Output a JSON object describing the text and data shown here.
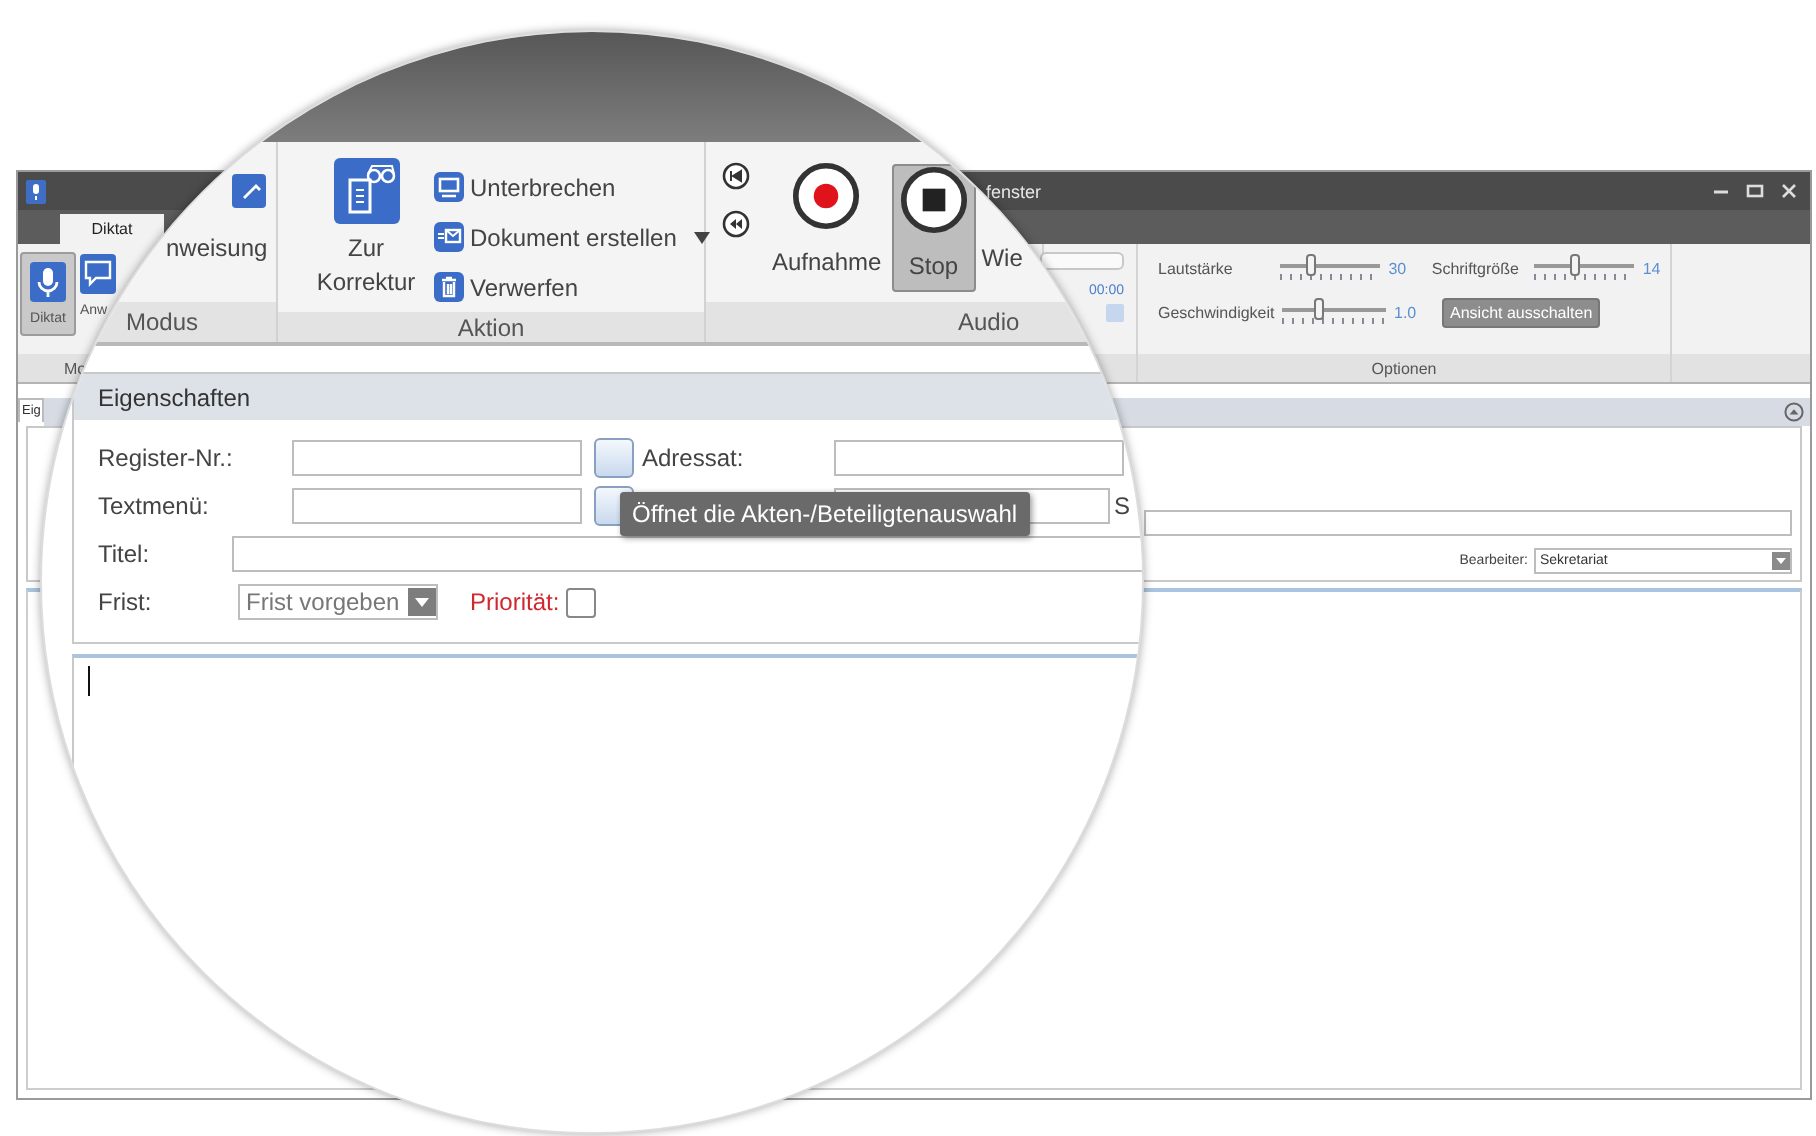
{
  "window": {
    "title": "fenster"
  },
  "ribbon_tabs": [
    {
      "label": "Diktat",
      "selected": true
    }
  ],
  "modus_group": {
    "label": "Mo",
    "buttons": [
      {
        "label": "Diktat",
        "kind": "mic",
        "selected": true
      },
      {
        "label": "Anw",
        "kind": "bubble",
        "selected": false
      }
    ]
  },
  "audio_group": {
    "time": "00:00"
  },
  "options_group": {
    "label": "Optionen",
    "sliders": [
      {
        "label": "Lautstärke",
        "level": 0.3,
        "reading": "30"
      },
      {
        "label": "Schriftgröße",
        "level": 0.4,
        "reading": "14"
      },
      {
        "label": "Geschwindigkeit",
        "level": 0.35,
        "reading": "1.0"
      }
    ],
    "button": "Ansicht ausschalten"
  },
  "panel_tab": {
    "label": "Eig"
  },
  "panel": {
    "editor_label": "Bearbeiter:",
    "editor_value": "Sekretariat"
  },
  "magnifier": {
    "ribbon": {
      "modus": {
        "label": "Modus",
        "button": "nweisung"
      },
      "aktion": {
        "label": "Aktion",
        "large_button": "Zur Korrektur",
        "small_buttons": [
          {
            "label": "Unterbrechen",
            "kind": "pause",
            "dropdown": false
          },
          {
            "label": "Dokument erstellen",
            "kind": "document",
            "dropdown": true
          },
          {
            "label": "Verwerfen",
            "kind": "trash",
            "dropdown": false
          }
        ]
      },
      "audio": {
        "label": "Audio",
        "buttons": [
          {
            "label": "Aufnahme",
            "kind": "record",
            "selected": false
          },
          {
            "label": "Stop",
            "kind": "stop",
            "selected": true
          },
          {
            "label": "Wie",
            "kind": "text",
            "selected": false
          }
        ]
      }
    },
    "properties": {
      "title": "Eigenschaften",
      "register_label": "Register-Nr.:",
      "addressee_label": "Adressat:",
      "textmenu_label": "Textmenü:",
      "cut_label": "S",
      "title_label": "Titel:",
      "deadline_label": "Frist:",
      "deadline_value": "Frist vorgeben",
      "priority_label": "Priorität:",
      "priority_checked": false,
      "tooltip": "Öffnet die Akten-/Beteiligtenauswahl"
    }
  }
}
